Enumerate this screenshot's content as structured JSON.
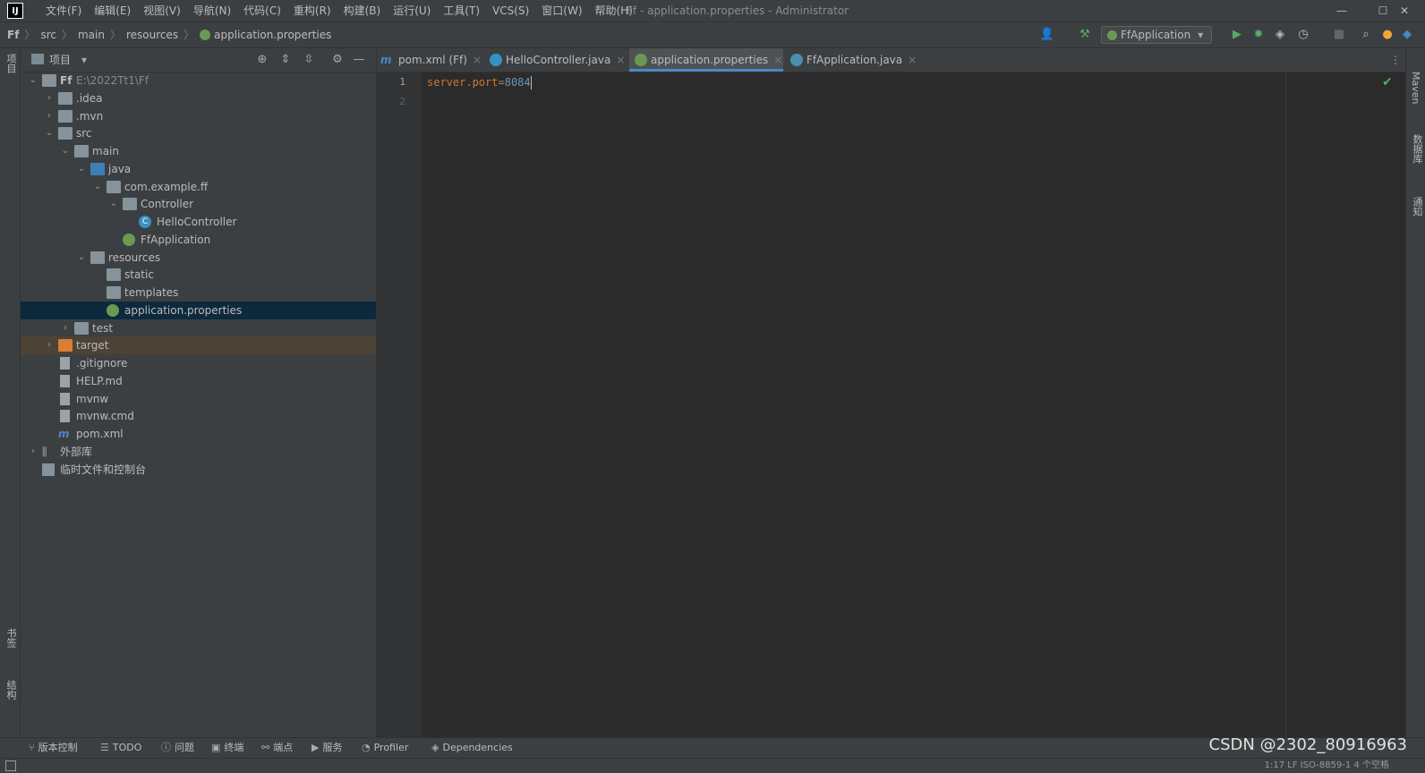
{
  "titlebar": {
    "logo": "IJ",
    "menu": [
      "文件(F)",
      "编辑(E)",
      "视图(V)",
      "导航(N)",
      "代码(C)",
      "重构(R)",
      "构建(B)",
      "运行(U)",
      "工具(T)",
      "VCS(S)",
      "窗口(W)",
      "帮助(H)"
    ],
    "window_title": "Ff - application.properties - Administrator",
    "minimize": "—",
    "maximize": "☐",
    "close": "✕"
  },
  "navbar": {
    "crumbs": [
      "Ff",
      "src",
      "main",
      "resources",
      "application.properties"
    ],
    "run_config": "FfApplication"
  },
  "left_stripe": {
    "project": "项目",
    "bookmarks": "书签",
    "structure": "结构"
  },
  "right_stripe": {
    "maven": "Maven",
    "database": "数据库",
    "notifications": "通知"
  },
  "project_panel": {
    "title": "项目",
    "tree": [
      {
        "label": "Ff",
        "extra": "E:\\2022Tt1\\Ff",
        "depth": 0,
        "arrow": "down",
        "icon": "module"
      },
      {
        "label": ".idea",
        "depth": 1,
        "arrow": "right",
        "icon": "folder"
      },
      {
        "label": ".mvn",
        "depth": 1,
        "arrow": "right",
        "icon": "folder"
      },
      {
        "label": "src",
        "depth": 1,
        "arrow": "down",
        "icon": "folder"
      },
      {
        "label": "main",
        "depth": 2,
        "arrow": "down",
        "icon": "folder"
      },
      {
        "label": "java",
        "depth": 3,
        "arrow": "down",
        "icon": "folder-blue"
      },
      {
        "label": "com.example.ff",
        "depth": 4,
        "arrow": "down",
        "icon": "package"
      },
      {
        "label": "Controller",
        "depth": 5,
        "arrow": "down",
        "icon": "package"
      },
      {
        "label": "HelloController",
        "depth": 6,
        "arrow": "",
        "icon": "class"
      },
      {
        "label": "FfApplication",
        "depth": 5,
        "arrow": "",
        "icon": "spring-class"
      },
      {
        "label": "resources",
        "depth": 3,
        "arrow": "down",
        "icon": "folder-res"
      },
      {
        "label": "static",
        "depth": 4,
        "arrow": "",
        "icon": "folder"
      },
      {
        "label": "templates",
        "depth": 4,
        "arrow": "",
        "icon": "folder"
      },
      {
        "label": "application.properties",
        "depth": 4,
        "arrow": "",
        "icon": "spring-file",
        "selected": true
      },
      {
        "label": "test",
        "depth": 2,
        "arrow": "right",
        "icon": "folder"
      },
      {
        "label": "target",
        "depth": 1,
        "arrow": "right",
        "icon": "folder-orange",
        "excluded": true
      },
      {
        "label": ".gitignore",
        "depth": 1,
        "arrow": "",
        "icon": "file"
      },
      {
        "label": "HELP.md",
        "depth": 1,
        "arrow": "",
        "icon": "md-file"
      },
      {
        "label": "mvnw",
        "depth": 1,
        "arrow": "",
        "icon": "script-file"
      },
      {
        "label": "mvnw.cmd",
        "depth": 1,
        "arrow": "",
        "icon": "file"
      },
      {
        "label": "pom.xml",
        "depth": 1,
        "arrow": "",
        "icon": "maven-file"
      },
      {
        "label": "外部库",
        "depth": 0,
        "arrow": "right",
        "icon": "library"
      },
      {
        "label": "临时文件和控制台",
        "depth": 0,
        "arrow": "",
        "icon": "scratch"
      }
    ]
  },
  "editor": {
    "tabs": [
      {
        "label": "pom.xml (Ff)",
        "icon": "maven",
        "active": false
      },
      {
        "label": "HelloController.java",
        "icon": "class",
        "active": false
      },
      {
        "label": "application.properties",
        "icon": "spring",
        "active": true
      },
      {
        "label": "FfApplication.java",
        "icon": "spring-class",
        "active": false
      }
    ],
    "line_numbers": [
      "1",
      "2"
    ],
    "code": {
      "key": "server.port",
      "eq": "=",
      "value": "8084"
    }
  },
  "bottom_tools": [
    "版本控制",
    "TODO",
    "问题",
    "终端",
    "端点",
    "服务",
    "Profiler",
    "Dependencies"
  ],
  "status": {
    "text": "1:17   LF   ISO-8859-1   4 个空格"
  },
  "watermark": "CSDN @2302_80916963",
  "colors": {
    "accent": "#4a88c7",
    "selection": "#0d293e",
    "keyword": "#cc7832",
    "number": "#6897bb"
  }
}
